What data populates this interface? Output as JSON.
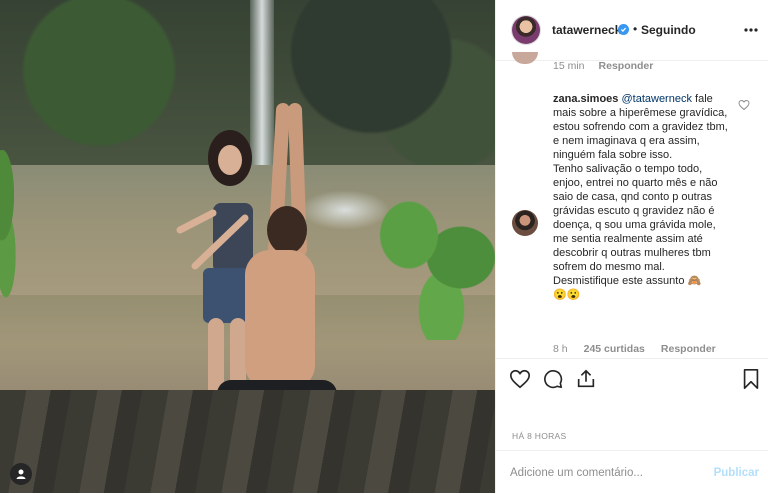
{
  "header": {
    "username": "tatawerneck",
    "separator": "•",
    "follow_status": "Seguindo"
  },
  "previous_comment": {
    "time": "15 min",
    "reply": "Responder"
  },
  "comment": {
    "username": "zana.simoes",
    "mention": "@tatawerneck",
    "text_part1": " fale mais sobre a hiperêmese gravídica, estou sofrendo com a gravidez tbm, e nem imaginava q era assim, ninguém fala sobre isso.",
    "text_part2": "Tenho salivação o tempo todo, enjoo, entrei no quarto mês e não saio de casa, qnd conto p outras grávidas escuto q gravidez não é doença, q sou uma grávida mole, me sentia realmente assim até descobrir q outras mulheres tbm sofrem do mesmo mal. Desmistifique este assunto 🙈",
    "text_part3": "😮😮",
    "time": "8 h",
    "likes": "245 curtidas",
    "reply": "Responder"
  },
  "post": {
    "time_ago": "HÁ 8 HORAS"
  },
  "add_comment": {
    "placeholder": "Adicione um comentário...",
    "post_label": "Publicar"
  },
  "colors": {
    "accent": "#3897f0",
    "post_disabled": "#b2dffc",
    "muted": "#8e8e8e"
  },
  "icons": {
    "more": "more-horizontal-icon",
    "like": "heart-icon",
    "comment": "comment-icon",
    "share": "share-icon",
    "save": "bookmark-icon",
    "tags": "user-tag-icon"
  }
}
